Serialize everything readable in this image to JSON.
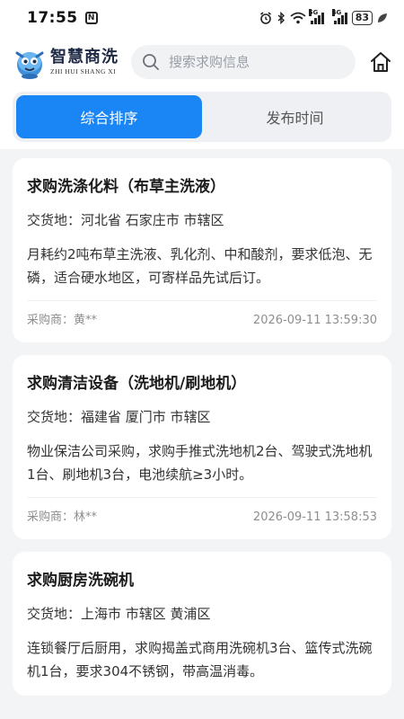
{
  "status_bar": {
    "time": "17:55",
    "nfc": "N",
    "battery": "83",
    "signal1_label": "5G",
    "signal2_label": "4G"
  },
  "header": {
    "brand_cn": "智慧商洗",
    "brand_en": "ZHI HUI SHANG XI",
    "search_placeholder": "搜索求购信息"
  },
  "tabs": [
    {
      "label": "综合排序",
      "active": true
    },
    {
      "label": "发布时间",
      "active": false
    }
  ],
  "listings": [
    {
      "title": "求购洗涤化料（布草主洗液）",
      "location": "交货地：河北省 石家庄市 市辖区",
      "description": "月耗约2吨布草主洗液、乳化剂、中和酸剂，要求低泡、无磷，适合硬水地区，可寄样品先试后订。",
      "buyer": "采购商：黄**",
      "time": "2026-09-11 13:59:30"
    },
    {
      "title": "求购清洁设备（洗地机/刷地机）",
      "location": "交货地：福建省 厦门市 市辖区",
      "description": "物业保洁公司采购，求购手推式洗地机2台、驾驶式洗地机1台、刷地机3台，电池续航≥3小时。",
      "buyer": "采购商：林**",
      "time": "2026-09-11 13:58:53"
    },
    {
      "title": "求购厨房洗碗机",
      "location": "交货地：上海市 市辖区 黄浦区",
      "description": "连锁餐厅后厨用，求购揭盖式商用洗碗机3台、篮传式洗碗机1台，要求304不锈钢，带高温消毒。",
      "buyer": "",
      "time": ""
    }
  ]
}
